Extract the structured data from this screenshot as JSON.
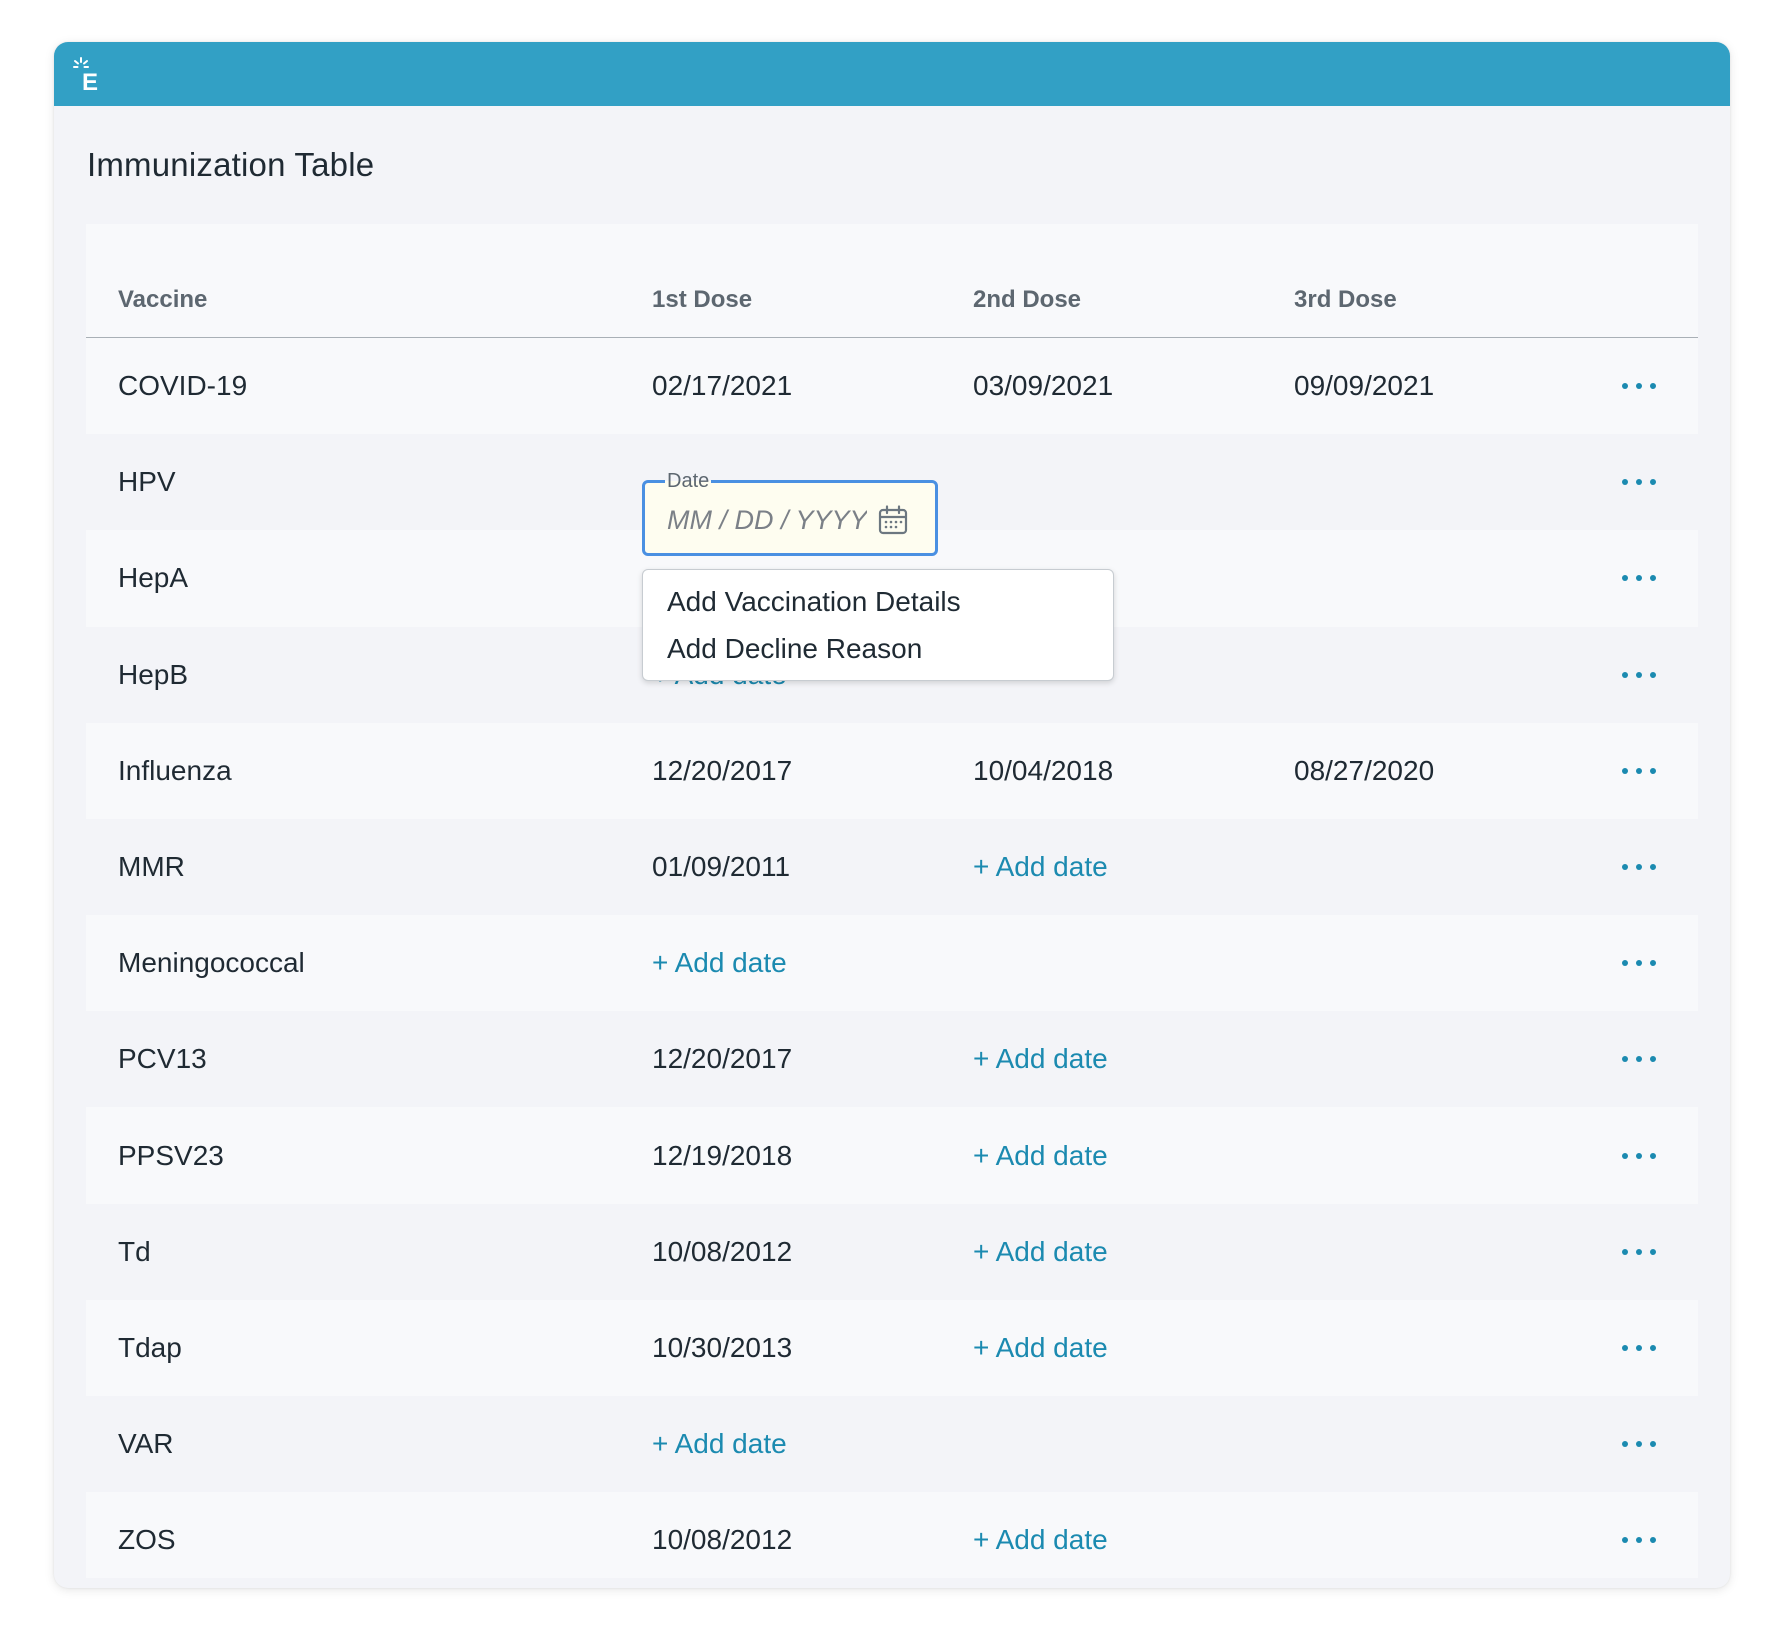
{
  "page": {
    "title": "Immunization Table"
  },
  "colors": {
    "header": "#32a0c5",
    "link": "#1b8ab0",
    "focus": "#4a90e2"
  },
  "table": {
    "columns": [
      "Vaccine",
      "1st Dose",
      "2nd Dose",
      "3rd Dose"
    ],
    "rows": [
      {
        "vaccine": "COVID-19",
        "d1": "02/17/2021",
        "d2": "03/09/2021",
        "d3": "09/09/2021"
      },
      {
        "vaccine": "HPV",
        "d1": "",
        "d2": "",
        "d3": ""
      },
      {
        "vaccine": "HepA",
        "d1": "",
        "d2": "",
        "d3": ""
      },
      {
        "vaccine": "HepB",
        "d1": "+ Add date",
        "d2": "",
        "d3": ""
      },
      {
        "vaccine": "Influenza",
        "d1": "12/20/2017",
        "d2": "10/04/2018",
        "d3": "08/27/2020"
      },
      {
        "vaccine": "MMR",
        "d1": "01/09/2011",
        "d2": "+ Add date",
        "d3": ""
      },
      {
        "vaccine": "Meningococcal",
        "d1": "+ Add date",
        "d2": "",
        "d3": ""
      },
      {
        "vaccine": "PCV13",
        "d1": "12/20/2017",
        "d2": "+ Add date",
        "d3": ""
      },
      {
        "vaccine": "PPSV23",
        "d1": "12/19/2018",
        "d2": "+ Add date",
        "d3": ""
      },
      {
        "vaccine": "Td",
        "d1": "10/08/2012",
        "d2": "+ Add date",
        "d3": ""
      },
      {
        "vaccine": "Tdap",
        "d1": "10/30/2013",
        "d2": "+ Add date",
        "d3": ""
      },
      {
        "vaccine": "VAR",
        "d1": "+ Add date",
        "d2": "",
        "d3": ""
      },
      {
        "vaccine": "ZOS",
        "d1": "10/08/2012",
        "d2": "+ Add date",
        "d3": ""
      }
    ]
  },
  "date_field": {
    "label": "Date",
    "placeholder": "MM / DD / YYYY",
    "value": ""
  },
  "menu": {
    "items": [
      "Add Vaccination Details",
      "Add Decline Reason"
    ]
  },
  "icons": {
    "logo": "epic-logo-icon",
    "calendar": "calendar-icon",
    "more": "more-horizontal-icon"
  }
}
